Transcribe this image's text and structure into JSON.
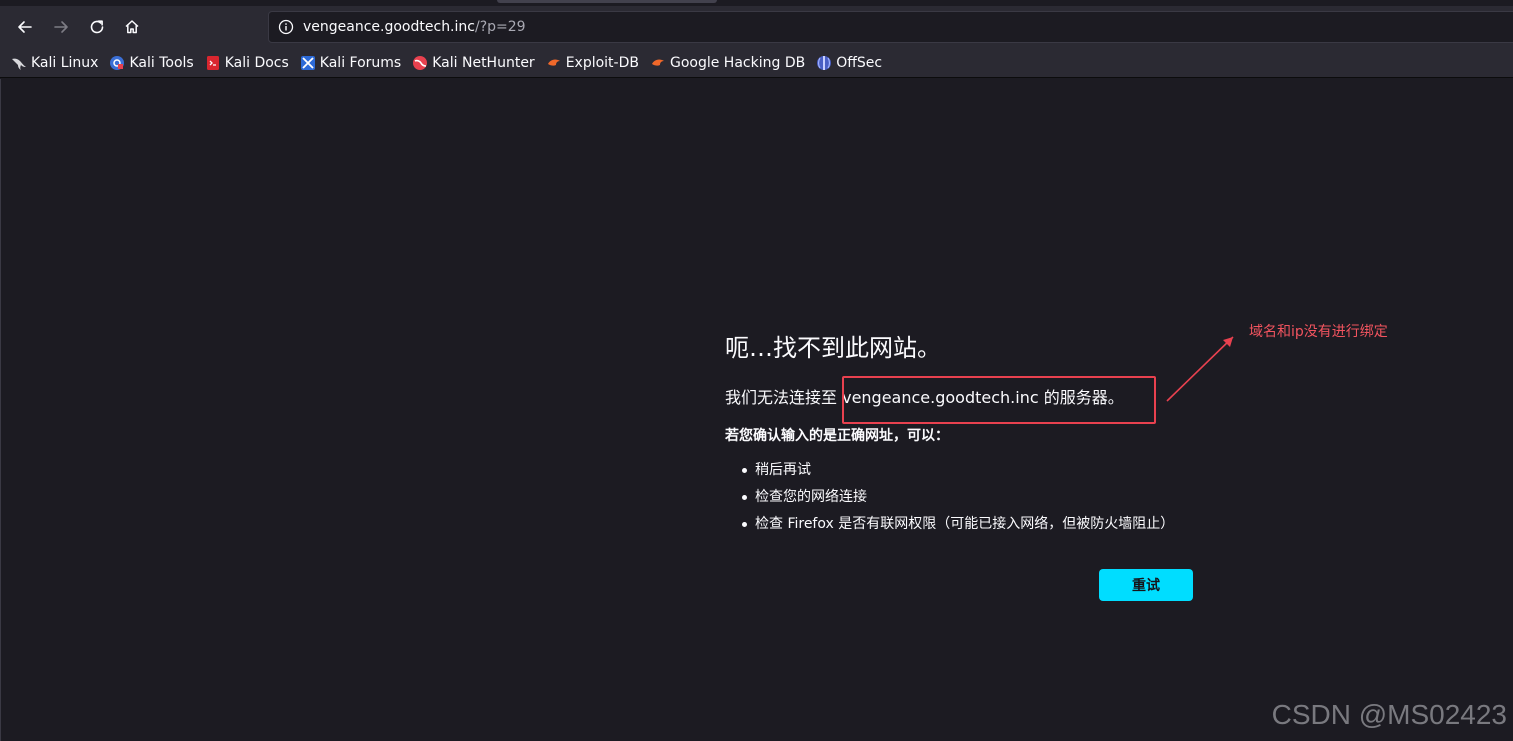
{
  "browser": {
    "url_domain": "vengeance.goodtech.inc",
    "url_path": "/?p=29"
  },
  "bookmarks": [
    {
      "label": "Kali Linux",
      "icon": "kali-dragon-icon"
    },
    {
      "label": "Kali Tools",
      "icon": "kali-tools-icon"
    },
    {
      "label": "Kali Docs",
      "icon": "kali-docs-icon"
    },
    {
      "label": "Kali Forums",
      "icon": "kali-forums-icon"
    },
    {
      "label": "Kali NetHunter",
      "icon": "kali-nethunter-icon"
    },
    {
      "label": "Exploit-DB",
      "icon": "exploit-db-icon"
    },
    {
      "label": "Google Hacking DB",
      "icon": "ghdb-icon"
    },
    {
      "label": "OffSec",
      "icon": "offsec-icon"
    }
  ],
  "error": {
    "title": "呃…找不到此网站。",
    "desc_prefix": "我们无法连接至",
    "desc_host": " vengeance.goodtech.inc 的服务器。",
    "sub": "若您确认输入的是正确网址，可以：",
    "items": [
      "稍后再试",
      "检查您的网络连接",
      "检查 Firefox 是否有联网权限（可能已接入网络，但被防火墙阻止）"
    ],
    "retry_label": "重试"
  },
  "annotation": {
    "text": "域名和ip没有进行绑定",
    "color": "#e8414f"
  },
  "watermark": "CSDN @MS02423",
  "colors": {
    "accent": "#00ddff",
    "toolbar": "#2b2a33",
    "page": "#1c1b22"
  }
}
